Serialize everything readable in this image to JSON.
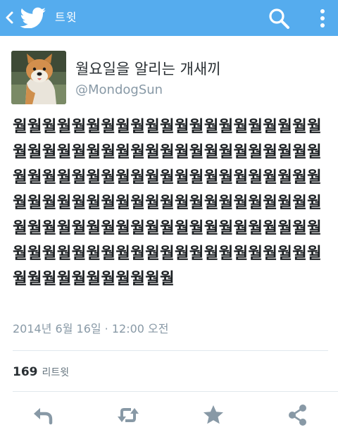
{
  "header": {
    "title": "트윗",
    "back_icon": "chevron-left-icon",
    "logo_icon": "twitter-bird-icon",
    "search_icon": "search-icon",
    "overflow_icon": "more-vertical-icon",
    "bar_color": "#55acee"
  },
  "tweet": {
    "display_name": "월요일을 알리는 개새끼",
    "handle": "@MondogSun",
    "text": "월월월월월월월월월월월월월월월월월월월월월월월월월월월월월월월월월월월월월월월월월월월월월월월월월월월월월월월월월월월월월월월월월월월월월월월월월월월월월월월월월월월월월월월월월월월월월월월월월월월월월월월월월월월월월월월월월월월월월월월월월월월월월월월월월월월월월월월월월",
    "timestamp": "2014년 6월 16일 · 12:00 오전"
  },
  "stats": {
    "retweet_count": "169",
    "retweet_label": "리트윗"
  },
  "actions": [
    {
      "icon": "reply-icon"
    },
    {
      "icon": "retweet-icon"
    },
    {
      "icon": "favorite-star-icon"
    },
    {
      "icon": "share-icon"
    }
  ],
  "colors": {
    "accent": "#55acee",
    "action_icon": "#8899a6",
    "secondary_text": "#8899a6"
  }
}
